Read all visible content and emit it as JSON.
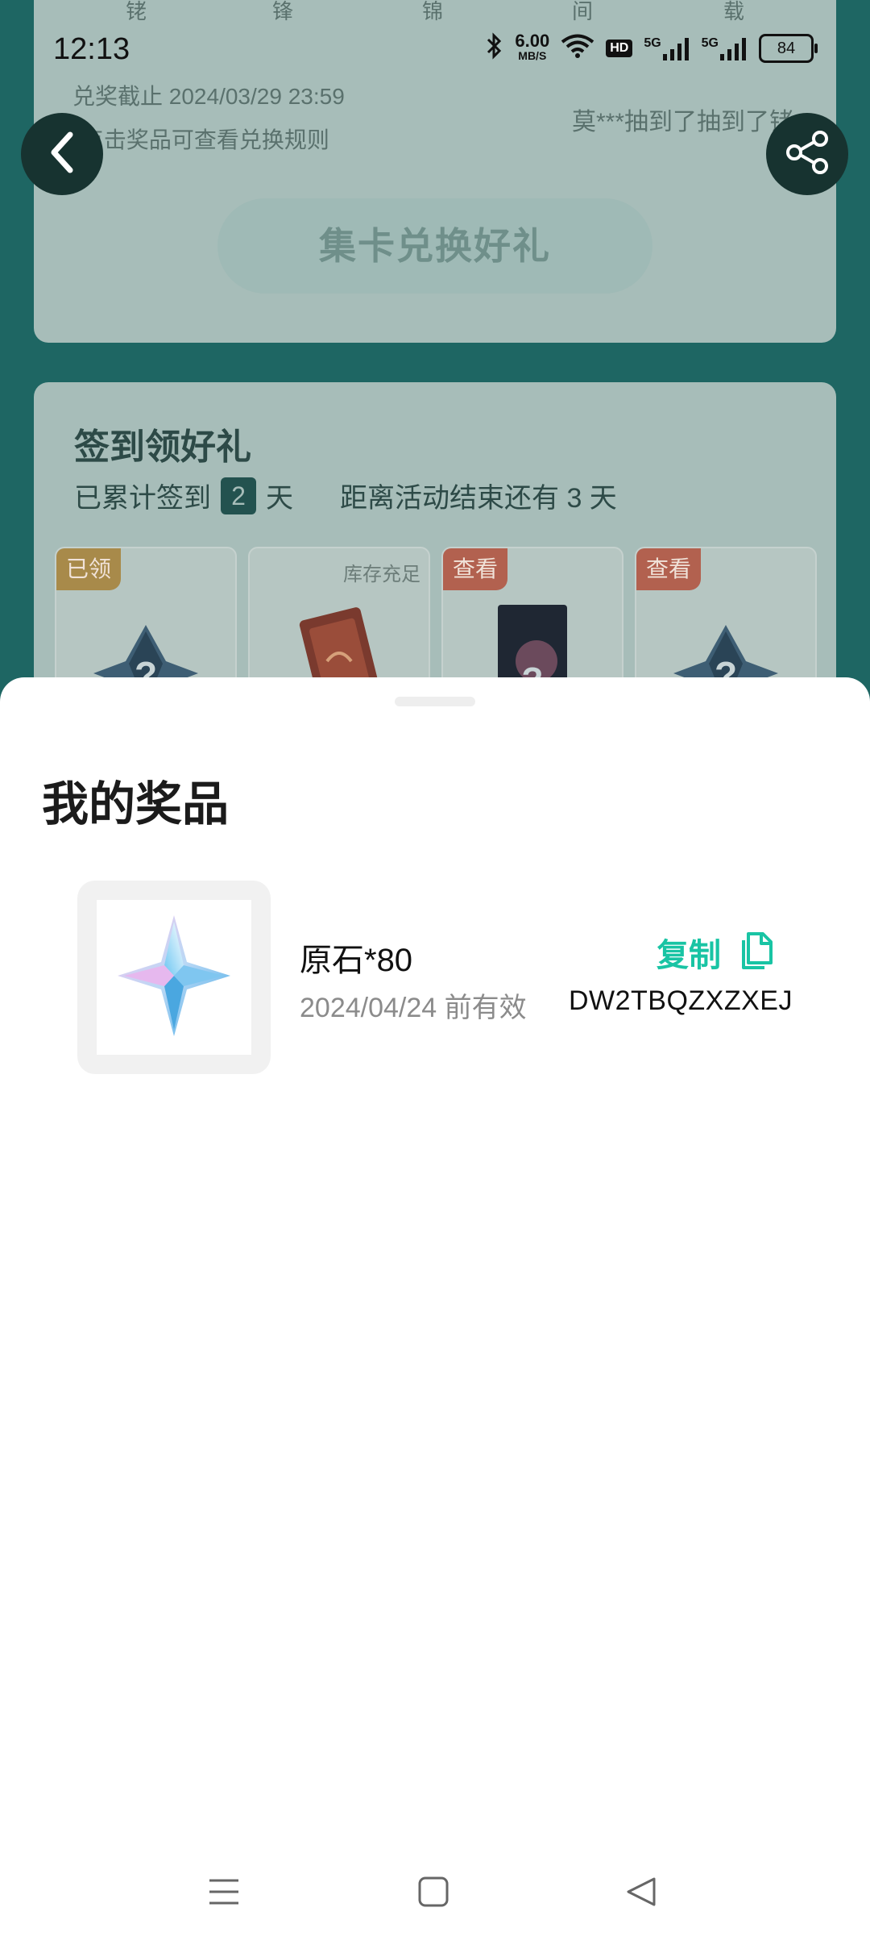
{
  "status_bar": {
    "time": "12:13",
    "net_speed": "6.00",
    "net_unit": "MB/S",
    "hd_label": "HD",
    "signal1_label": "5G",
    "signal2_label": "5G",
    "battery": "84"
  },
  "background": {
    "top_strip_chars": [
      "铑",
      "锋",
      "锦",
      "间",
      "载"
    ],
    "deadline": "兑奖截止 2024/03/29 23:59",
    "hint": "*点击奖品可查看兑换规则",
    "marquee": "莫***抽到了抽到了铑",
    "redeem_button": "集卡兑换好礼",
    "sign_title": "签到领好礼",
    "sign_prefix": "已累计签到",
    "sign_days": "2",
    "sign_day_unit": "天",
    "sign_remaining": "距离活动结束还有 3 天",
    "tiles": [
      {
        "badge": "已领",
        "badge_type": "got",
        "art": "question-gem-icon"
      },
      {
        "stock": "库存充足",
        "art": "ticket-card-icon"
      },
      {
        "badge": "查看",
        "badge_type": "view",
        "art": "book-cover-icon"
      },
      {
        "badge": "查看",
        "badge_type": "view",
        "art": "question-gem-icon"
      }
    ]
  },
  "sheet": {
    "title": "我的奖品",
    "prizes": [
      {
        "name": "原石*80",
        "expiry": "2024/04/24 前有效",
        "copy_label": "复制",
        "code": "DW2TBQZXZXEJ",
        "icon": "primogem-icon"
      }
    ]
  },
  "colors": {
    "accent": "#19c4a4",
    "background_page": "#1e6663",
    "sheet": "#ffffff"
  }
}
